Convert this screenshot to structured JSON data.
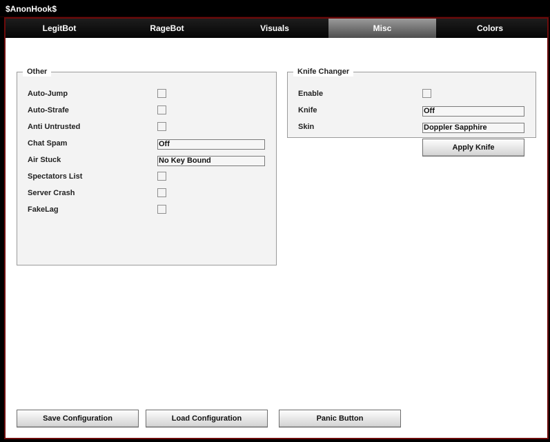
{
  "window": {
    "title": "$AnonHook$"
  },
  "tabs": [
    {
      "label": "LegitBot"
    },
    {
      "label": "RageBot"
    },
    {
      "label": "Visuals"
    },
    {
      "label": "Misc"
    },
    {
      "label": "Colors"
    }
  ],
  "active_tab": "Misc",
  "other": {
    "title": "Other",
    "auto_jump": "Auto-Jump",
    "auto_strafe": "Auto-Strafe",
    "anti_untrusted": "Anti Untrusted",
    "chat_spam": "Chat Spam",
    "chat_spam_value": "Off",
    "air_stuck": "Air Stuck",
    "air_stuck_value": "No Key Bound",
    "spectators_list": "Spectators List",
    "server_crash": "Server Crash",
    "fakelag": "FakeLag"
  },
  "knife": {
    "title": "Knife Changer",
    "enable": "Enable",
    "knife_label": "Knife",
    "knife_value": "Off",
    "skin_label": "Skin",
    "skin_value": "Doppler Sapphire",
    "apply": "Apply Knife"
  },
  "footer": {
    "save": "Save Configuration",
    "load": "Load Configuration",
    "panic": "Panic Button"
  },
  "colors": {
    "frame_border": "#6e0b0b",
    "active_tab": "#7a7a7a",
    "tabbar": "#0d0d0d"
  }
}
